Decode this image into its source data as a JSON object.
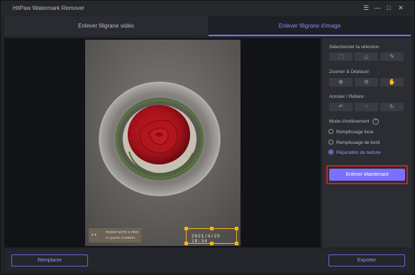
{
  "window": {
    "title": "HitPaw Watermark Remover"
  },
  "tabs": [
    {
      "label": "Enlever filigrane vidéo"
    },
    {
      "label": "Enlever filigrane d'image"
    }
  ],
  "panel": {
    "selection_title": "Sélectionner la sélection",
    "zoom_title": "Zoomer & Déplacer",
    "undo_title": "Annuler / Refaire",
    "mode_title": "Mode d'enlèvement",
    "modes": [
      {
        "label": "Remplissage lisse"
      },
      {
        "label": "Remplissage de bord"
      },
      {
        "label": "Réparation de texture"
      }
    ],
    "selected_mode": "Réparation de texture",
    "remove_button": "Enlever Maintenant"
  },
  "image": {
    "camera_watermark_line1": "REDMI NOTE 8 PRO",
    "camera_watermark_line2": "AI QUAD CAMERA",
    "date_watermark": "2021/4/25 18:34"
  },
  "footer": {
    "replace_button": "Remplacer",
    "export_button": "Exporter"
  },
  "colors": {
    "accent": "#7b70ff",
    "highlight_border": "#d11f24",
    "selection_box": "#f0b81a"
  }
}
